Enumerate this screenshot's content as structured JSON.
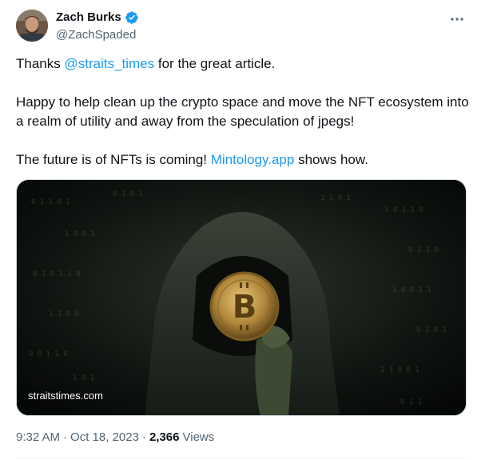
{
  "tweet": {
    "author": {
      "display_name": "Zach Burks",
      "handle": "@ZachSpaded",
      "verified_color": "#1d9bf0"
    },
    "more_icon": "more-horizontal-icon",
    "text": {
      "line1_prefix": "Thanks ",
      "line1_mention": "@straits_times",
      "line1_suffix": " for the great article.",
      "paragraph2": "Happy to help clean up the crypto space and move the NFT ecosystem into a realm of utility and away from the speculation of jpegs!",
      "line3_prefix": "The future is of NFTs is coming! ",
      "line3_link": "Mintology.app",
      "line3_suffix": " shows how."
    },
    "media": {
      "source_label": "straitstimes.com"
    },
    "meta": {
      "time": "9:32 AM",
      "sep1": "·",
      "date": "Oct 18, 2023",
      "sep2": "·",
      "views_count": "2,366",
      "views_label": "Views"
    }
  },
  "colors": {
    "link": "#1d9bf0",
    "secondary_text": "#536471",
    "primary_text": "#0f1419"
  }
}
